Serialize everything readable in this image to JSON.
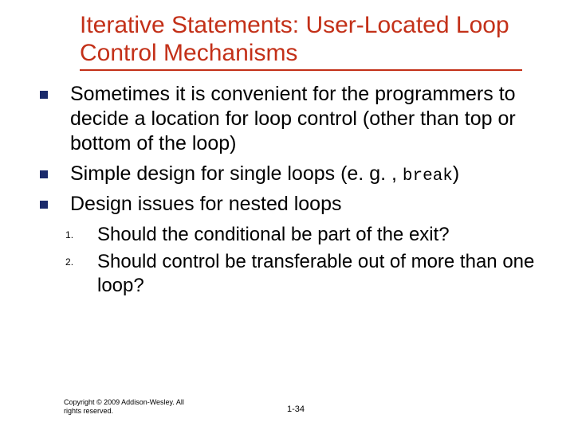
{
  "title": "Iterative Statements: User-Located Loop Control Mechanisms",
  "body": {
    "b1": "Sometimes it is convenient for the programmers to decide a location for loop control (other than top or bottom of the loop)",
    "b2_pre": "Simple design for single loops (e. g. , ",
    "b2_code": "break",
    "b2_post": ")",
    "b3": "Design issues for nested loops"
  },
  "sub": {
    "s1": "Should the conditional be part of the exit?",
    "s2": "Should control be transferable out of more than one loop?"
  },
  "footer": "Copyright © 2009 Addison-Wesley. All rights reserved.",
  "pagenum": "1-34"
}
